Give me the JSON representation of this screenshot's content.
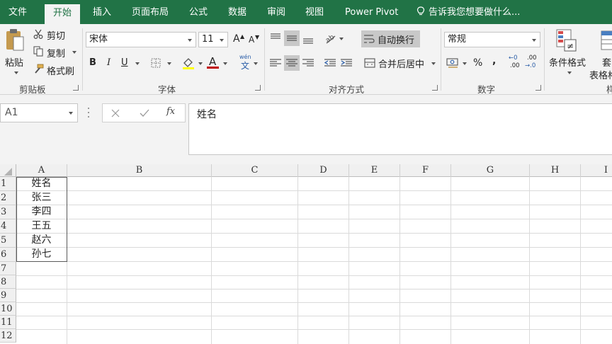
{
  "tabs": [
    "文件",
    "开始",
    "插入",
    "页面布局",
    "公式",
    "数据",
    "审阅",
    "视图",
    "Power Pivot"
  ],
  "active_tab": "开始",
  "tell_me": "告诉我您想要做什么...",
  "ribbon": {
    "clipboard": {
      "paste": "粘贴",
      "cut": "剪切",
      "copy": "复制",
      "format_painter": "格式刷",
      "label": "剪贴板"
    },
    "font": {
      "font_name": "宋体",
      "font_size": "11",
      "bold": "B",
      "italic": "I",
      "underline": "U",
      "font_color_letter": "A",
      "phonetic": "wén",
      "phonetic_char": "文",
      "label": "字体",
      "increase_size": "A",
      "decrease_size": "A"
    },
    "alignment": {
      "wrap_text": "自动换行",
      "merge_center": "合并后居中",
      "label": "对齐方式"
    },
    "number": {
      "format": "常规",
      "percent": "%",
      "comma": ",",
      "inc_decimal_a": "←0",
      "inc_decimal_b": ".00",
      "dec_decimal_a": ".00",
      "dec_decimal_b": "→.0",
      "label": "数字"
    },
    "styles": {
      "conditional_format": "条件格式",
      "table_format_partial_top": "套",
      "table_format_partial_bottom": "表格格",
      "partial_label": "样"
    }
  },
  "formula_bar": {
    "name_box": "A1",
    "fx": "fx",
    "content": "姓名"
  },
  "sheet": {
    "columns": [
      "A",
      "B",
      "C",
      "D",
      "E",
      "F",
      "G",
      "H",
      "I"
    ],
    "rows": [
      "1",
      "2",
      "3",
      "4",
      "5",
      "6",
      "7",
      "8",
      "9",
      "10",
      "11",
      "12"
    ],
    "column_a_values": [
      "姓名",
      "张三",
      "李四",
      "王五",
      "赵六",
      "孙七"
    ]
  },
  "colors": {
    "brand_green": "#217346",
    "ribbon_bg": "#f3f3f3",
    "font_color_bar": "#c00000",
    "fill_color_bar": "#ffff00"
  }
}
